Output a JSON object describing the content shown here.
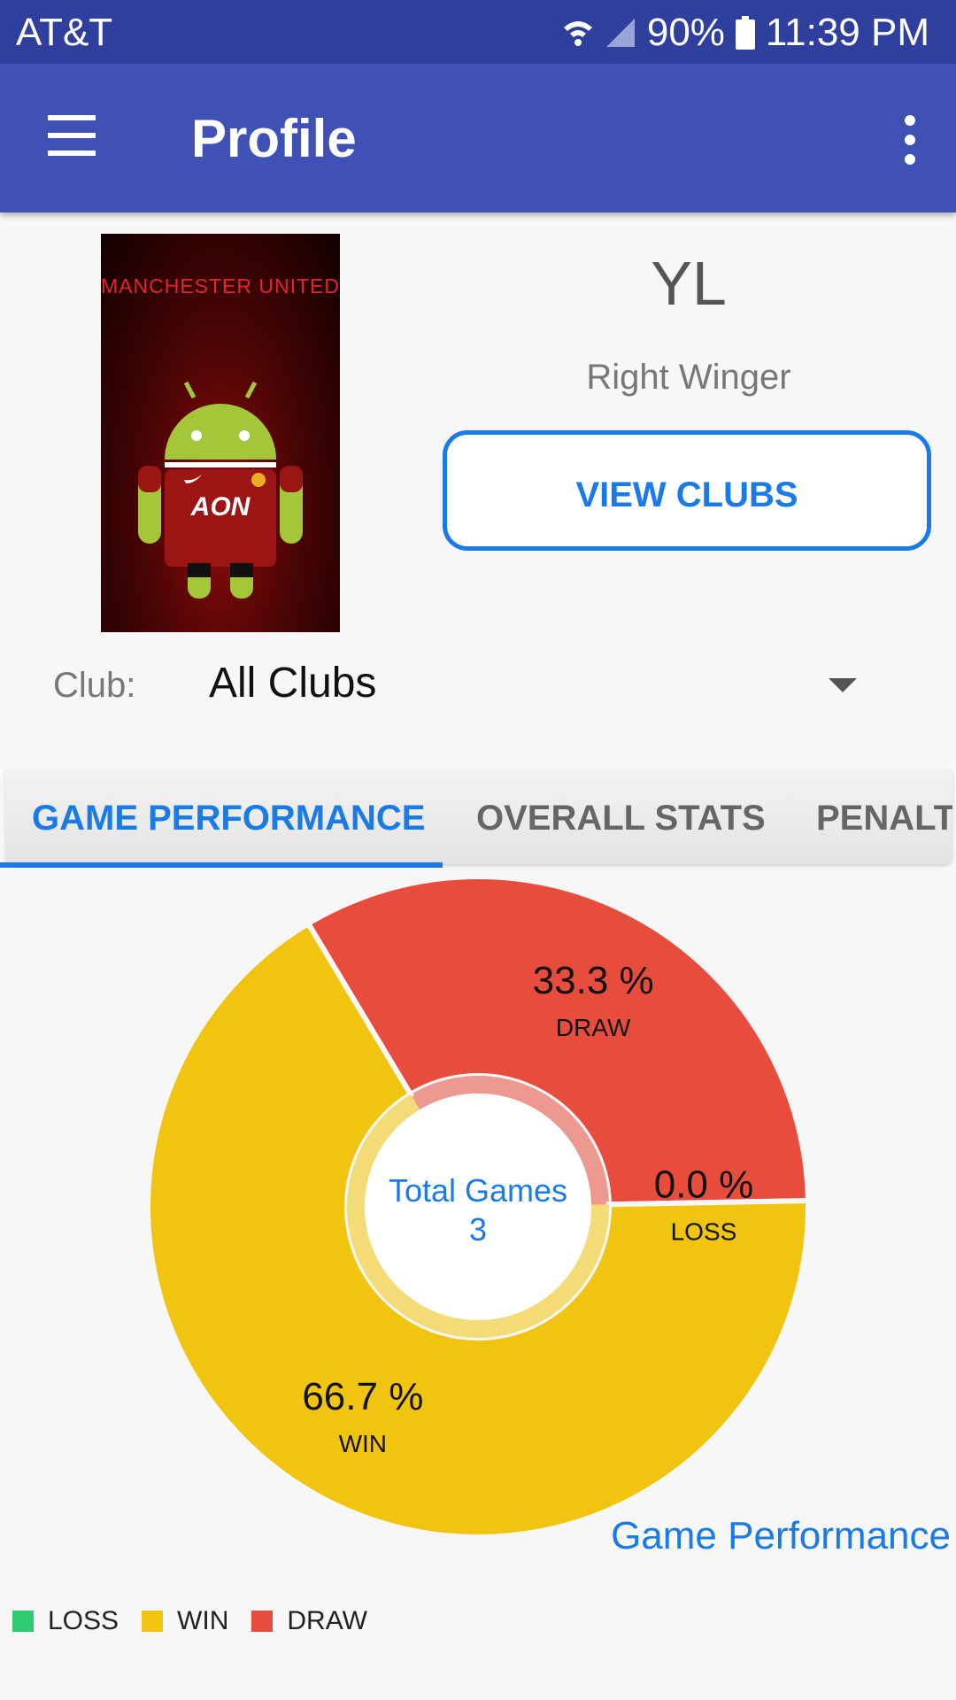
{
  "status_bar": {
    "carrier": "AT&T",
    "battery": "90%",
    "time": "11:39 PM"
  },
  "app_bar": {
    "title": "Profile"
  },
  "profile": {
    "avatar_caption": "MANCHESTER UNITED",
    "sponsor_text": "AON",
    "name": "YL",
    "position": "Right Winger",
    "view_clubs_label": "VIEW CLUBS"
  },
  "club_filter": {
    "label": "Club:",
    "selected": "All Clubs"
  },
  "tabs": [
    {
      "label": "GAME PERFORMANCE",
      "active": true
    },
    {
      "label": "OVERALL STATS",
      "active": false
    },
    {
      "label": "PENALTY",
      "active": false
    }
  ],
  "chart_data": {
    "type": "pie",
    "title": "Game Performance",
    "center_label": "Total Games",
    "center_value": "3",
    "slices": [
      {
        "label": "DRAW",
        "value": 33.3,
        "display": "33.3 %",
        "color": "#e84c3d"
      },
      {
        "label": "LOSS",
        "value": 0.0,
        "display": "0.0 %",
        "color": "#2ecc71"
      },
      {
        "label": "WIN",
        "value": 66.7,
        "display": "66.7 %",
        "color": "#f1c40f"
      }
    ],
    "legend": [
      {
        "label": "LOSS",
        "color": "#2ecc71"
      },
      {
        "label": "WIN",
        "color": "#f1c40f"
      },
      {
        "label": "DRAW",
        "color": "#e84c3d"
      }
    ],
    "legend_position": "bottom-left"
  }
}
